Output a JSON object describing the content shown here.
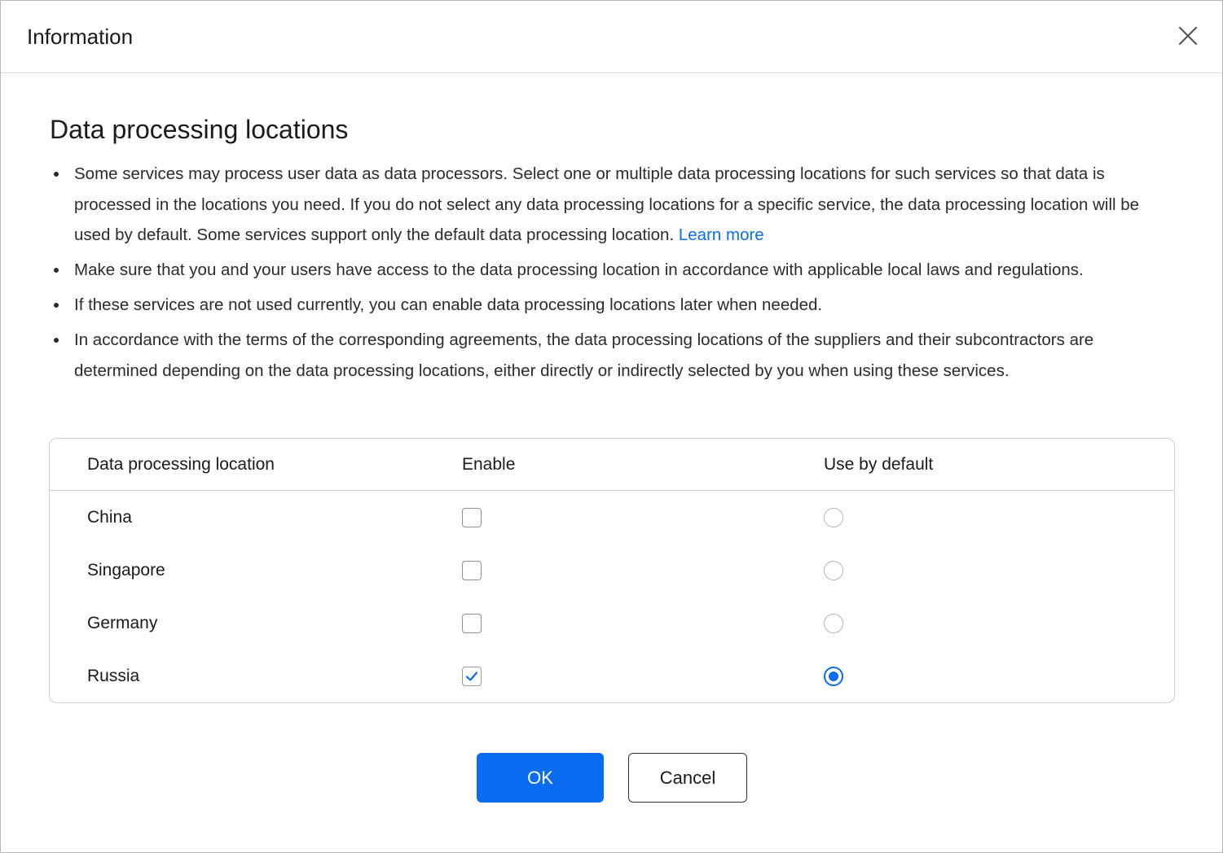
{
  "dialog": {
    "title": "Information",
    "close_icon": "close-icon"
  },
  "content": {
    "title": "Data processing locations",
    "bullets": [
      {
        "text": "Some services may process user data as data processors. Select one or multiple data processing locations for such services so that data is processed in the locations you need. If you do not select any data processing locations for a specific service, the data processing location will be used by default. Some services support only the default data processing location. ",
        "link": "Learn more"
      },
      {
        "text": "Make sure that you and your users have access to the data processing location in accordance with applicable local laws and regulations."
      },
      {
        "text": "If these services are not used currently, you can enable data processing locations later when needed."
      },
      {
        "text": "In accordance with the terms of the corresponding agreements, the data processing locations of the suppliers and their subcontractors are determined depending on the data processing locations, either directly or indirectly selected by you when using these services."
      }
    ]
  },
  "table": {
    "headers": {
      "location": "Data processing location",
      "enable": "Enable",
      "default": "Use by default"
    },
    "rows": [
      {
        "location": "China",
        "enabled": false,
        "default": false
      },
      {
        "location": "Singapore",
        "enabled": false,
        "default": false
      },
      {
        "location": "Germany",
        "enabled": false,
        "default": false
      },
      {
        "location": "Russia",
        "enabled": true,
        "default": true
      }
    ]
  },
  "footer": {
    "ok_label": "OK",
    "cancel_label": "Cancel"
  },
  "colors": {
    "accent": "#0a6cf0",
    "border": "#cfcfcf"
  }
}
